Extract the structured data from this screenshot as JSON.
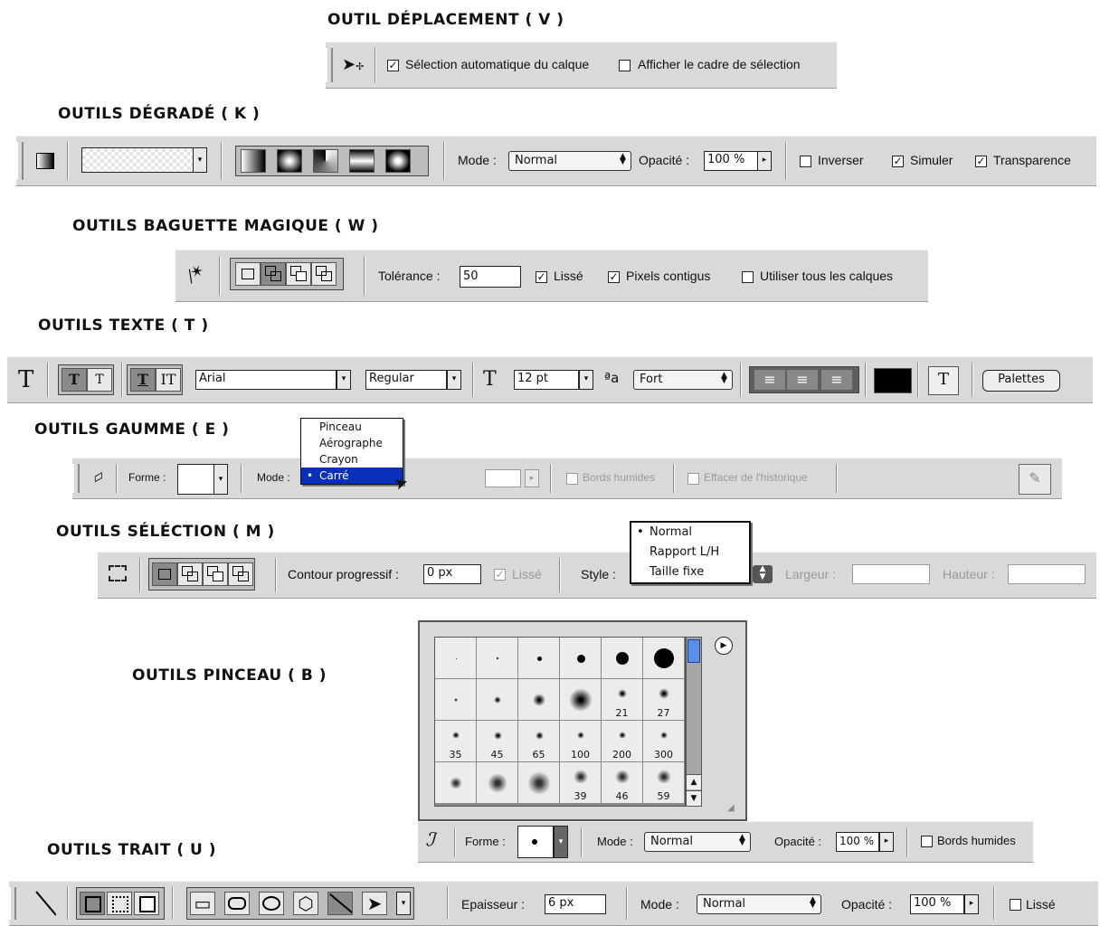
{
  "sections": {
    "move": {
      "title": "OUTIL DÉPLACEMENT ( V )",
      "auto_select": "Sélection automatique du calque",
      "show_bounds": "Afficher le cadre de sélection"
    },
    "gradient": {
      "title": "OUTILS DÉGRADÉ ( K )",
      "mode_label": "Mode :",
      "mode_value": "Normal",
      "opacity_label": "Opacité :",
      "opacity_value": "100 %",
      "reverse": "Inverser",
      "dither": "Simuler",
      "transparency": "Transparence"
    },
    "wand": {
      "title": "OUTILS BAGUETTE MAGIQUE ( W )",
      "tolerance_label": "Tolérance :",
      "tolerance_value": "50",
      "antialias": "Lissé",
      "contiguous": "Pixels contigus",
      "all_layers": "Utiliser tous les calques"
    },
    "text": {
      "title": "OUTILS TEXTE ( T )",
      "font": "Arial",
      "style": "Regular",
      "size": "12 pt",
      "aa": "Fort",
      "palettes": "Palettes"
    },
    "eraser": {
      "title": "OUTILS GAUMME ( E )",
      "shape_label": "Forme :",
      "mode_label": "Mode :",
      "wet_edges": "Bords humides",
      "erase_history": "Effacer de l'historique",
      "menu": [
        "Pinceau",
        "Aérographe",
        "Crayon",
        "Carré"
      ],
      "menu_selected": "Carré"
    },
    "marquee": {
      "title": "OUTILS SÉLÉCTION ( M )",
      "feather_label": "Contour progressif :",
      "feather_value": "0 px",
      "antialias": "Lissé",
      "style_label": "Style :",
      "width_label": "Largeur :",
      "height_label": "Hauteur :",
      "style_menu": [
        "Normal",
        "Rapport L/H",
        "Taille fixe"
      ],
      "style_selected": "Normal"
    },
    "brush": {
      "title": "OUTILS PINCEAU ( B )",
      "shape_label": "Forme :",
      "mode_label": "Mode :",
      "mode_value": "Normal",
      "opacity_label": "Opacité :",
      "opacity_value": "100 %",
      "wet_edges": "Bords humides",
      "sizes_row2": [
        "",
        "",
        "",
        "",
        "21",
        "27"
      ],
      "sizes_row3": [
        "35",
        "45",
        "65",
        "100",
        "200",
        "300"
      ],
      "sizes_row4": [
        "",
        "",
        "",
        "39",
        "46",
        "59"
      ]
    },
    "line": {
      "title": "OUTILS TRAIT ( U )",
      "weight_label": "Epaisseur :",
      "weight_value": "6 px",
      "mode_label": "Mode :",
      "mode_value": "Normal",
      "opacity_label": "Opacité :",
      "opacity_value": "100 %",
      "antialias": "Lissé"
    }
  },
  "icons": {
    "check": "☑",
    "radio_dot": "•",
    "dropdown": "▾",
    "play": "▸",
    "updown": "⇕"
  }
}
